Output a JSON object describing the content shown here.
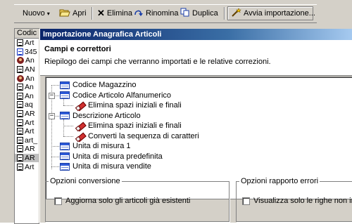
{
  "toolbar": {
    "new_label": "Nuovo",
    "open_label": "Apri",
    "delete_label": "Elimina",
    "rename_label": "Rinomina",
    "duplicate_label": "Duplica",
    "import_label": "Avvia importazione..."
  },
  "list": {
    "header": "Codic",
    "rows": [
      {
        "text": "Art",
        "icon": "doc-icon"
      },
      {
        "text": "345",
        "icon": "doc-blue-icon"
      },
      {
        "text": "An",
        "icon": "person-icon"
      },
      {
        "text": "AN",
        "icon": "doc-icon"
      },
      {
        "text": "An",
        "icon": "person-icon"
      },
      {
        "text": "An",
        "icon": "doc-icon"
      },
      {
        "text": "An",
        "icon": "doc-icon"
      },
      {
        "text": "aq",
        "icon": "doc-icon"
      },
      {
        "text": "AR",
        "icon": "doc-icon"
      },
      {
        "text": "Art",
        "icon": "doc-icon"
      },
      {
        "text": "Art",
        "icon": "doc-icon"
      },
      {
        "text": "art_",
        "icon": "doc-icon"
      },
      {
        "text": "AR",
        "icon": "doc-icon"
      },
      {
        "text": "AR",
        "icon": "doc-icon",
        "selected": true
      },
      {
        "text": "Art",
        "icon": "doc-icon"
      }
    ]
  },
  "dialog": {
    "title": "Importazione Anagrafica Articoli",
    "header_title": "Campi e correttori",
    "header_subtitle": "Riepilogo dei campi che verranno importati e le relative correzioni.",
    "tree": [
      {
        "label": "Codice Magazzino",
        "icon": "table-icon",
        "level": 0
      },
      {
        "label": "Codice Articolo Alfanumerico",
        "icon": "table-icon",
        "level": 0,
        "expander": "−"
      },
      {
        "label": "Elimina spazi iniziali e finali",
        "icon": "eraser-icon",
        "level": 1
      },
      {
        "label": "Descrizione Articolo",
        "icon": "table-icon",
        "level": 0,
        "expander": "−"
      },
      {
        "label": "Elimina spazi iniziali e finali",
        "icon": "eraser-icon",
        "level": 1
      },
      {
        "label": "Converti la sequenza di caratteri",
        "icon": "eraser-icon",
        "level": 1
      },
      {
        "label": "Unita di misura 1",
        "icon": "table-icon",
        "level": 0
      },
      {
        "label": "Unita di misura predefinita",
        "icon": "table-icon",
        "level": 0
      },
      {
        "label": "Unita di misura vendite",
        "icon": "table-icon",
        "level": 0
      }
    ],
    "conversion": {
      "legend": "Opzioni conversione",
      "checkbox_label": "Aggiorna solo gli articoli già esistenti"
    },
    "errors": {
      "legend": "Opzioni rapporto errori",
      "checkbox_label": "Visualizza solo le righe non imp"
    }
  },
  "colors": {
    "titlebar": "#0a246a",
    "window": "#d4d0c8"
  }
}
